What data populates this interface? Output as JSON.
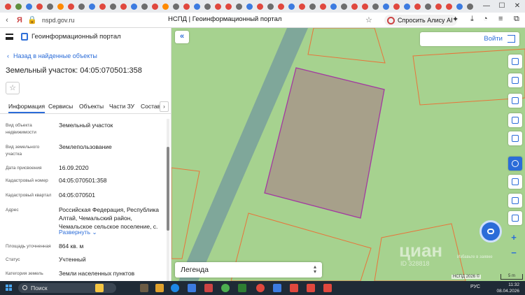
{
  "browser": {
    "url": "nspd.gov.ru",
    "page_title": "НСПД | Геоинформационный портал",
    "alisa_button": "Спросить Алису AI",
    "tab_colors": [
      "#e0483e",
      "#5f8f3e",
      "#3c7be0",
      "#e0483e",
      "#6d6d6d",
      "#ff8a00",
      "#e0483e",
      "#6d6d6d",
      "#3c7be0",
      "#e0483e",
      "#6d6d6d",
      "#e0483e",
      "#3c7be0",
      "#6d6d6d",
      "#e0483e",
      "#ff8a00",
      "#6d6d6d",
      "#e0483e",
      "#3c7be0",
      "#6d6d6d",
      "#e0483e",
      "#e0483e",
      "#6d6d6d",
      "#3c7be0",
      "#e0483e",
      "#6d6d6d",
      "#e0483e",
      "#3c7be0",
      "#e0483e",
      "#6d6d6d",
      "#e0483e",
      "#3c7be0",
      "#6d6d6d",
      "#e0483e",
      "#e0483e",
      "#6d6d6d",
      "#3c7be0",
      "#e0483e",
      "#3c7be0",
      "#e0483e",
      "#6d6d6d",
      "#e0483e",
      "#e0483e",
      "#3c7be0",
      "#6d6d6d"
    ]
  },
  "sidebar": {
    "portal_name": "Геоинформационный портал",
    "back_link": "Назад в найденные объекты",
    "title": "Земельный участок: 04:05:070501:358",
    "tabs": [
      "Информация",
      "Сервисы",
      "Объекты",
      "Части ЗУ",
      "Состав"
    ],
    "active_tab": "Информация",
    "fields": [
      {
        "label": "Вид объекта недвижимости",
        "value": "Земельный участок"
      },
      {
        "label": "Вид земельного участка",
        "value": "Землепользование"
      },
      {
        "label": "Дата присвоения",
        "value": "16.09.2020"
      },
      {
        "label": "Кадастровый номер",
        "value": "04:05:070501:358"
      },
      {
        "label": "Кадастровый квартал",
        "value": "04:05:070501"
      },
      {
        "label": "Адрес",
        "value": "Российская Федерация, Республика Алтай, Чемальский район, Чемальское сельское поселение, с."
      },
      {
        "label": "Площадь уточненная",
        "value": "864 кв. м"
      },
      {
        "label": "Статус",
        "value": "Учтенный"
      },
      {
        "label": "Категория земель",
        "value": "Земли населенных пунктов"
      }
    ],
    "expand_link": "Развернуть"
  },
  "map": {
    "login_label": "Войти",
    "legend_label": "Легенда",
    "attribution": "НСПД 2026 ©",
    "scale": "5 m",
    "watermark": "циан",
    "watermark_id": "ID 328818",
    "watermark_small": "Избавьте в заявке",
    "zoom_in": "+",
    "zoom_out": "−",
    "colors": {
      "grass": "#a6d28f",
      "road": "#7fa79a",
      "parcel_fill": "#a7a08a",
      "parcel_border": "#a23aa0",
      "neighbor_border": "#e8743a",
      "accent": "#2b6cd8"
    }
  },
  "taskbar": {
    "search_label": "Поиск",
    "lang": "РУС",
    "time": "11:32",
    "date": "08.04.2026"
  }
}
